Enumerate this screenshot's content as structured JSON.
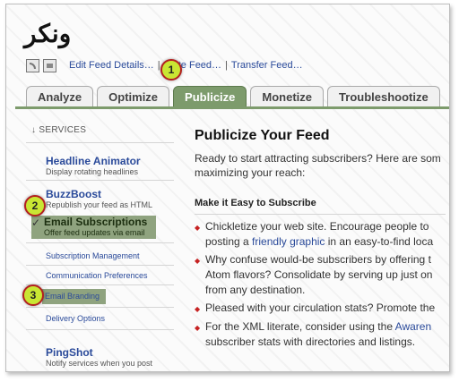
{
  "title": "ونكر",
  "toolbar": {
    "edit": "Edit Feed Details…",
    "sep1": "|",
    "delete": "ete Feed…",
    "sep2": "|",
    "transfer": "Transfer Feed…",
    "icons": [
      "feed-icon",
      "page-icon"
    ]
  },
  "tabs": [
    {
      "label": "Analyze",
      "active": false
    },
    {
      "label": "Optimize",
      "active": false
    },
    {
      "label": "Publicize",
      "active": true
    },
    {
      "label": "Monetize",
      "active": false
    },
    {
      "label": "Troubleshootize",
      "active": false
    }
  ],
  "sidebar": {
    "heading": "↓ SERVICES",
    "items": {
      "headline": {
        "title": "Headline Animator",
        "desc": "Display rotating headlines"
      },
      "buzzboost": {
        "title": "BuzzBoost",
        "desc": "Republish your feed as HTML"
      },
      "email": {
        "check": "✓",
        "title": "Email Subscriptions",
        "desc": "Offer feed updates via email"
      },
      "submgmt": "Subscription Management",
      "commprefs": "Communication Preferences",
      "branding": "Email Branding",
      "delivery": "Delivery Options",
      "pingshot": {
        "title": "PingShot",
        "desc": "Notify services when you post"
      }
    }
  },
  "badges": {
    "b1": "1",
    "b2": "2",
    "b3": "3"
  },
  "main": {
    "title": "Publicize Your Feed",
    "intro1": "Ready to start attracting subscribers? Here are som",
    "intro2": "maximizing your reach:",
    "section": "Make it Easy to Subscribe",
    "bullets": {
      "b1a": "Chickletize your web site. Encourage people to",
      "b1b_pre": "posting a ",
      "b1b_link": "friendly graphic",
      "b1b_post": " in an easy-to-find loca",
      "b2a": "Why confuse would-be subscribers by offering t",
      "b2b": "Atom flavors? Consolidate by serving up just on",
      "b2c": "from any destination.",
      "b3a": "Pleased with your circulation stats? Promote the",
      "b4a_pre": "For the XML literate, consider using the ",
      "b4a_link": "Awaren",
      "b4b": "subscriber stats with directories and listings."
    }
  },
  "colors": {
    "accent": "#7d9b6c",
    "link": "#2a4a9a",
    "bullet": "#c62222",
    "badge": "#c9e633"
  }
}
